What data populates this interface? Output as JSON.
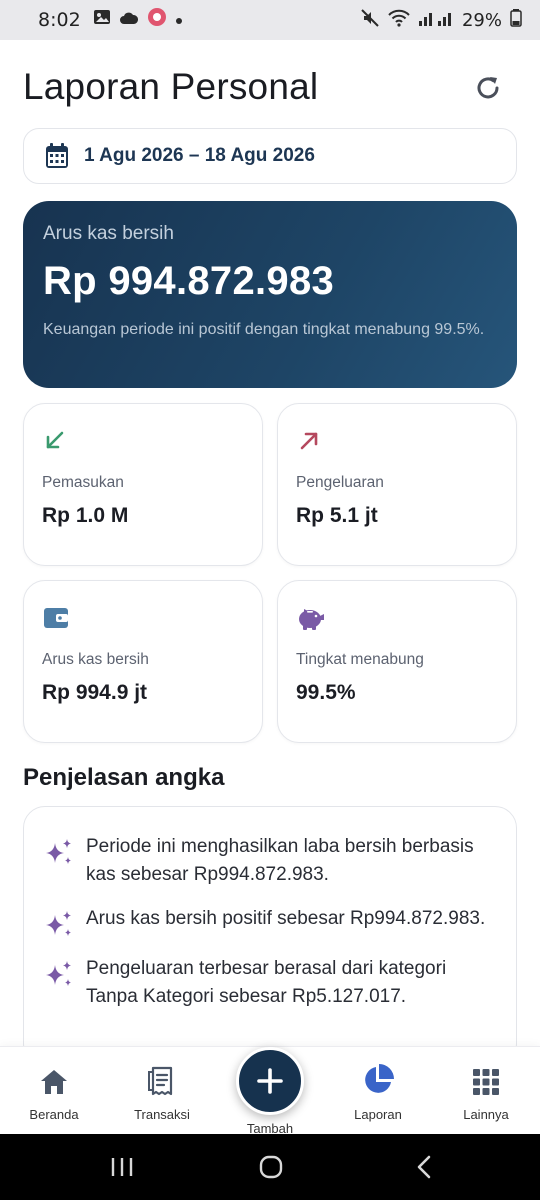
{
  "status_bar": {
    "time": "8:02",
    "battery": "29%",
    "icons": [
      "gallery-icon",
      "cloud-icon",
      "app-notification-icon",
      "dot-icon",
      "mute-icon",
      "wifi-icon",
      "signal-icon",
      "battery-icon"
    ]
  },
  "header": {
    "title": "Laporan Personal",
    "refresh_icon": "refresh-icon"
  },
  "date_range": {
    "icon": "calendar-icon",
    "label": "1 Agu 2026 – 18 Agu 2026"
  },
  "hero": {
    "label": "Arus kas bersih",
    "value": "Rp 994.872.983",
    "description": "Keuangan periode ini positif dengan tingkat menabung 99.5%."
  },
  "stats": [
    {
      "icon": "arrow-down-left-icon",
      "label": "Pemasukan",
      "value": "Rp 1.0 M",
      "color": "#3a9a6e"
    },
    {
      "icon": "arrow-up-right-icon",
      "label": "Pengeluaran",
      "value": "Rp 5.1 jt",
      "color": "#b5485e"
    },
    {
      "icon": "wallet-icon",
      "label": "Arus kas bersih",
      "value": "Rp 994.9 jt",
      "color": "#4e7ea6"
    },
    {
      "icon": "piggy-bank-icon",
      "label": "Tingkat menabung",
      "value": "99.5%",
      "color": "#7a5aa6"
    }
  ],
  "explanation": {
    "title": "Penjelasan angka",
    "items": [
      "Periode ini menghasilkan laba bersih berbasis kas sebesar Rp994.872.983.",
      "Arus kas bersih positif sebesar Rp994.872.983.",
      "Pengeluaran terbesar berasal dari kategori Tanpa Kategori sebesar Rp5.127.017."
    ]
  },
  "bottom_nav": {
    "items": [
      {
        "label": "Beranda",
        "icon": "home-icon"
      },
      {
        "label": "Transaksi",
        "icon": "receipt-icon"
      },
      {
        "label": "Tambah",
        "icon": "plus-icon"
      },
      {
        "label": "Laporan",
        "icon": "pie-chart-icon",
        "active": true
      },
      {
        "label": "Lainnya",
        "icon": "grid-icon"
      }
    ]
  },
  "colors": {
    "primary": "#16324e",
    "accent_purple": "#7a5aa6",
    "income_green": "#3a9a6e",
    "expense_red": "#b5485e"
  }
}
